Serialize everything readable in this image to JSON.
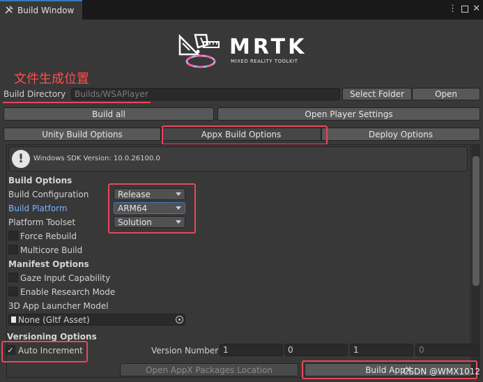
{
  "window": {
    "tab_title": "Build Window",
    "ghost_tab": "Build Window"
  },
  "logo": {
    "name": "MRTK",
    "tagline": "MIXED REALITY TOOLKIT"
  },
  "annotation": {
    "text": "文件生成位置"
  },
  "directory": {
    "label": "Build Directory",
    "value": "Builds/WSAPlayer",
    "select_folder": "Select Folder",
    "open": "Open"
  },
  "actions": {
    "build_all": "Build all",
    "open_player_settings": "Open Player Settings"
  },
  "tabs": [
    {
      "label": "Unity Build Options",
      "active": false
    },
    {
      "label": "Appx Build Options",
      "active": true
    },
    {
      "label": "Deploy Options",
      "active": false
    }
  ],
  "sdk": {
    "text": "Windows SDK Version: 10.0.26100.0"
  },
  "build_options": {
    "heading": "Build Options",
    "configuration_label": "Build Configuration",
    "configuration_value": "Release",
    "platform_label": "Build Platform",
    "platform_value": "ARM64",
    "toolset_label": "Platform Toolset",
    "toolset_value": "Solution",
    "force_rebuild": "Force Rebuild",
    "multicore_build": "Multicore Build"
  },
  "manifest": {
    "heading": "Manifest Options",
    "gaze_input": "Gaze Input Capability",
    "research_mode": "Enable Research Mode",
    "launcher_label": "3D App Launcher Model",
    "launcher_value": "None (Gltf Asset)"
  },
  "versioning": {
    "heading": "Versioning Options",
    "auto_increment": "Auto Increment",
    "auto_increment_checked": true,
    "version_label": "Version Number",
    "v1": "1",
    "v2": "0",
    "v3": "1",
    "v4": "0"
  },
  "footer": {
    "open_packages": "Open AppX Packages Location",
    "build_appx": "Build AppX",
    "watermark": "CSDN @WMX1012"
  },
  "colors": {
    "highlight": "#e8475b",
    "annotation": "#ff4d4d",
    "link_blue": "#7ab4ff",
    "focus_border": "#3a79bb"
  }
}
